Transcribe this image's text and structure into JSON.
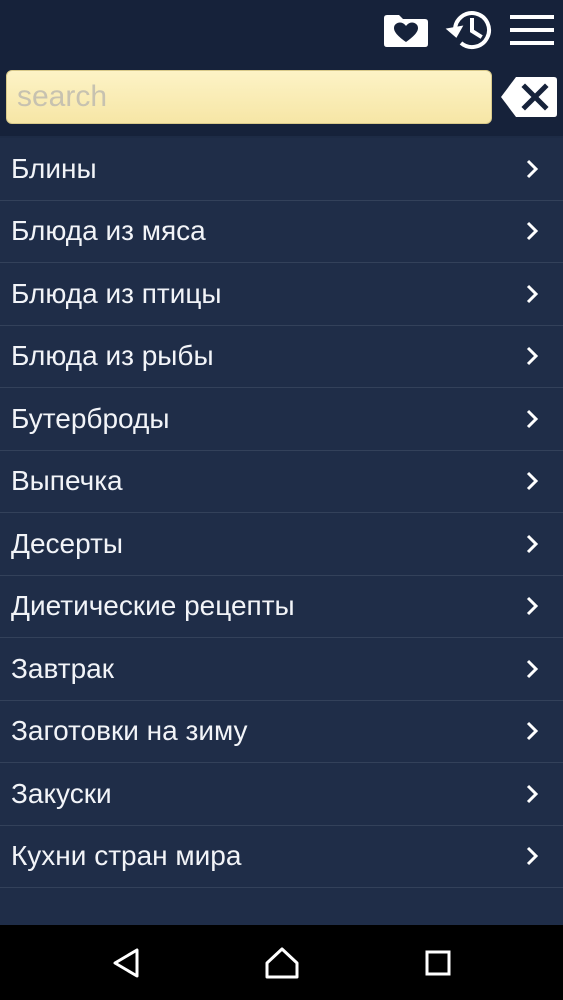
{
  "toolbar": {
    "icons": [
      "favorites-folder-heart-icon",
      "history-icon",
      "menu-icon"
    ]
  },
  "search": {
    "placeholder": "search",
    "value": "",
    "clear_icon": "backspace-clear-icon"
  },
  "categories": [
    {
      "label": "Блины"
    },
    {
      "label": "Блюда из мяса"
    },
    {
      "label": "Блюда из птицы"
    },
    {
      "label": "Блюда из рыбы"
    },
    {
      "label": "Бутерброды"
    },
    {
      "label": "Выпечка"
    },
    {
      "label": "Десерты"
    },
    {
      "label": "Диетические рецепты"
    },
    {
      "label": "Завтрак"
    },
    {
      "label": "Заготовки на зиму"
    },
    {
      "label": "Закуски"
    },
    {
      "label": "Кухни стран мира"
    }
  ],
  "navbar": {
    "icons": [
      "back-icon",
      "home-icon",
      "recents-icon"
    ]
  },
  "colors": {
    "background": "#1d2b45",
    "toolbar": "#16223a",
    "search_field": "#fbefbd",
    "text": "#f2f4f8",
    "divider": "#33415a"
  }
}
